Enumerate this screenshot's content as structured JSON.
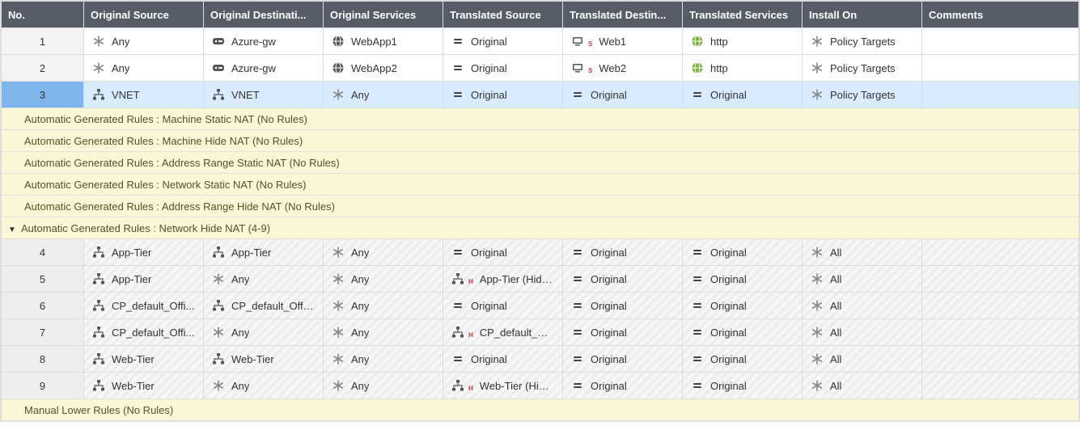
{
  "columns": [
    "No.",
    "Original Source",
    "Original Destinati...",
    "Original Services",
    "Translated Source",
    "Translated Destin...",
    "Translated Services",
    "Install On",
    "Comments"
  ],
  "rows": [
    {
      "type": "rule",
      "no": "1",
      "selected": false,
      "hatched": false,
      "cells": [
        {
          "icon": "asterisk",
          "label": "Any"
        },
        {
          "icon": "gateway",
          "label": "Azure-gw"
        },
        {
          "icon": "globe-dark",
          "label": "WebApp1"
        },
        {
          "icon": "equals",
          "label": "Original"
        },
        {
          "icon": "host",
          "sub": "S",
          "label": "Web1"
        },
        {
          "icon": "globe-green",
          "label": "http"
        },
        {
          "icon": "asterisk",
          "label": "Policy Targets"
        },
        {
          "icon": "none",
          "label": ""
        }
      ]
    },
    {
      "type": "rule",
      "no": "2",
      "selected": false,
      "hatched": false,
      "cells": [
        {
          "icon": "asterisk",
          "label": "Any"
        },
        {
          "icon": "gateway",
          "label": "Azure-gw"
        },
        {
          "icon": "globe-dark",
          "label": "WebApp2"
        },
        {
          "icon": "equals",
          "label": "Original"
        },
        {
          "icon": "host",
          "sub": "S",
          "label": "Web2"
        },
        {
          "icon": "globe-green",
          "label": "http"
        },
        {
          "icon": "asterisk",
          "label": "Policy Targets"
        },
        {
          "icon": "none",
          "label": ""
        }
      ]
    },
    {
      "type": "rule",
      "no": "3",
      "selected": true,
      "hatched": false,
      "cells": [
        {
          "icon": "network",
          "label": "VNET"
        },
        {
          "icon": "network",
          "label": "VNET"
        },
        {
          "icon": "asterisk",
          "label": "Any"
        },
        {
          "icon": "equals",
          "label": "Original"
        },
        {
          "icon": "equals",
          "label": "Original"
        },
        {
          "icon": "equals",
          "label": "Original"
        },
        {
          "icon": "asterisk",
          "label": "Policy Targets"
        },
        {
          "icon": "none",
          "label": ""
        }
      ]
    },
    {
      "type": "section",
      "label": "Automatic Generated Rules : Machine Static NAT (No Rules)"
    },
    {
      "type": "section",
      "label": "Automatic Generated Rules : Machine Hide NAT (No Rules)"
    },
    {
      "type": "section",
      "label": "Automatic Generated Rules : Address Range Static NAT (No Rules)"
    },
    {
      "type": "section",
      "label": "Automatic Generated Rules : Network Static NAT (No Rules)"
    },
    {
      "type": "section",
      "label": "Automatic Generated Rules : Address Range Hide NAT (No Rules)"
    },
    {
      "type": "section",
      "expandable": true,
      "expanded": true,
      "label": "Automatic Generated Rules : Network Hide NAT (4-9)"
    },
    {
      "type": "rule",
      "no": "4",
      "hatched": true,
      "cells": [
        {
          "icon": "network",
          "label": "App-Tier"
        },
        {
          "icon": "network",
          "label": "App-Tier"
        },
        {
          "icon": "asterisk",
          "label": "Any"
        },
        {
          "icon": "equals",
          "label": "Original"
        },
        {
          "icon": "equals",
          "label": "Original"
        },
        {
          "icon": "equals",
          "label": "Original"
        },
        {
          "icon": "asterisk",
          "label": "All"
        },
        {
          "icon": "none",
          "label": ""
        }
      ]
    },
    {
      "type": "rule",
      "no": "5",
      "hatched": true,
      "cells": [
        {
          "icon": "network",
          "label": "App-Tier"
        },
        {
          "icon": "asterisk",
          "label": "Any"
        },
        {
          "icon": "asterisk",
          "label": "Any"
        },
        {
          "icon": "network",
          "sub": "H",
          "label": "App-Tier (Hiding "
        },
        {
          "icon": "equals",
          "label": "Original"
        },
        {
          "icon": "equals",
          "label": "Original"
        },
        {
          "icon": "asterisk",
          "label": "All"
        },
        {
          "icon": "none",
          "label": ""
        }
      ]
    },
    {
      "type": "rule",
      "no": "6",
      "hatched": true,
      "cells": [
        {
          "icon": "network",
          "label": "CP_default_Offi..."
        },
        {
          "icon": "network",
          "label": "CP_default_Office"
        },
        {
          "icon": "asterisk",
          "label": "Any"
        },
        {
          "icon": "equals",
          "label": "Original"
        },
        {
          "icon": "equals",
          "label": "Original"
        },
        {
          "icon": "equals",
          "label": "Original"
        },
        {
          "icon": "asterisk",
          "label": "All"
        },
        {
          "icon": "none",
          "label": ""
        }
      ]
    },
    {
      "type": "rule",
      "no": "7",
      "hatched": true,
      "cells": [
        {
          "icon": "network",
          "label": "CP_default_Offi..."
        },
        {
          "icon": "asterisk",
          "label": "Any"
        },
        {
          "icon": "asterisk",
          "label": "Any"
        },
        {
          "icon": "network",
          "sub": "H",
          "label": "CP_default_Office"
        },
        {
          "icon": "equals",
          "label": "Original"
        },
        {
          "icon": "equals",
          "label": "Original"
        },
        {
          "icon": "asterisk",
          "label": "All"
        },
        {
          "icon": "none",
          "label": ""
        }
      ]
    },
    {
      "type": "rule",
      "no": "8",
      "hatched": true,
      "cells": [
        {
          "icon": "network",
          "label": "Web-Tier"
        },
        {
          "icon": "network",
          "label": "Web-Tier"
        },
        {
          "icon": "asterisk",
          "label": "Any"
        },
        {
          "icon": "equals",
          "label": "Original"
        },
        {
          "icon": "equals",
          "label": "Original"
        },
        {
          "icon": "equals",
          "label": "Original"
        },
        {
          "icon": "asterisk",
          "label": "All"
        },
        {
          "icon": "none",
          "label": ""
        }
      ]
    },
    {
      "type": "rule",
      "no": "9",
      "hatched": true,
      "cells": [
        {
          "icon": "network",
          "label": "Web-Tier"
        },
        {
          "icon": "asterisk",
          "label": "Any"
        },
        {
          "icon": "asterisk",
          "label": "Any"
        },
        {
          "icon": "network",
          "sub": "H",
          "label": "Web-Tier (Hiding"
        },
        {
          "icon": "equals",
          "label": "Original"
        },
        {
          "icon": "equals",
          "label": "Original"
        },
        {
          "icon": "asterisk",
          "label": "All"
        },
        {
          "icon": "none",
          "label": ""
        }
      ]
    },
    {
      "type": "section",
      "label": "Manual Lower Rules (No Rules)"
    }
  ]
}
